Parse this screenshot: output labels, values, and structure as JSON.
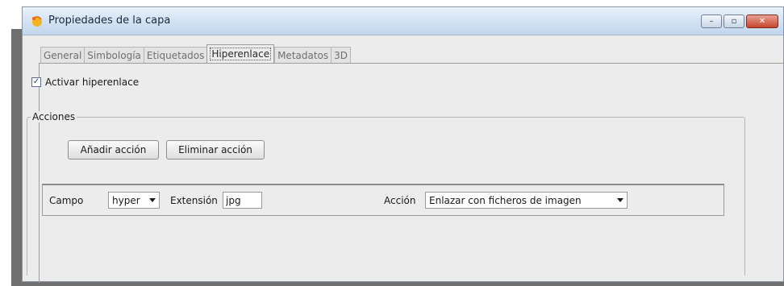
{
  "window": {
    "title": "Propiedades de la capa",
    "controls": {
      "minimize": "–",
      "maximize": "▫",
      "close": "✕"
    }
  },
  "tabs": [
    {
      "label": "General",
      "active": false
    },
    {
      "label": "Simbología",
      "active": false
    },
    {
      "label": "Etiquetados",
      "active": false
    },
    {
      "label": "Hiperenlace",
      "active": true
    },
    {
      "label": "Metadatos",
      "active": false
    },
    {
      "label": "3D",
      "active": false
    }
  ],
  "hyperlink": {
    "enable_label": "Activar hiperenlace",
    "enable_checked": true,
    "checkmark": "✓"
  },
  "actions": {
    "group_title": "Acciones",
    "add_button": "Añadir acción",
    "remove_button": "Eliminar acción",
    "row": {
      "field_label": "Campo",
      "field_value": "hyper",
      "extension_label": "Extensión",
      "extension_value": "jpg",
      "action_label": "Acción",
      "action_value": "Enlazar con ficheros de imagen"
    }
  },
  "icons": {
    "app": "app-layer-icon",
    "dropdown": "chevron-down-icon"
  }
}
